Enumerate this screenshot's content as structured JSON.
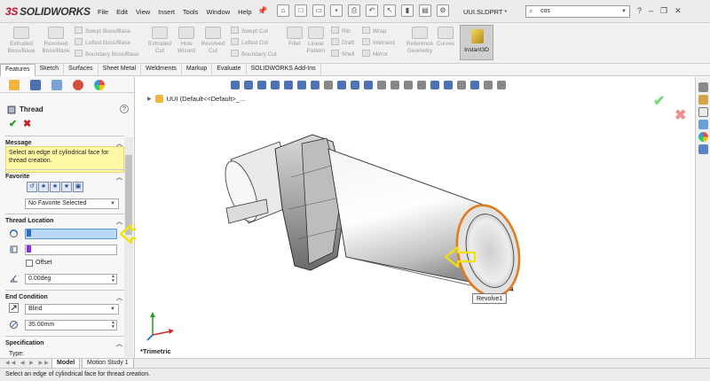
{
  "app": {
    "brand_ds": "3S",
    "brand_name": "SOLIDWORKS",
    "menu": [
      "File",
      "Edit",
      "View",
      "Insert",
      "Tools",
      "Window",
      "Help"
    ],
    "document": "UUI.SLDPRT *",
    "search_value": "cos"
  },
  "commands": {
    "extruded_boss": "Extruded Boss/Base",
    "revolved_boss": "Revolved Boss/Base",
    "swept_boss": "Swept Boss/Base",
    "lofted_boss": "Lofted Boss/Base",
    "boundary_boss": "Boundary Boss/Base",
    "extruded_cut": "Extruded Cut",
    "hole_wizard": "Hole Wizard",
    "revolved_cut": "Revolved Cut",
    "swept_cut": "Swept Cut",
    "lofted_cut": "Lofted Cut",
    "boundary_cut": "Boundary Cut",
    "fillet": "Fillet",
    "linear_pattern": "Linear Pattern",
    "rib": "Rib",
    "draft": "Draft",
    "shell": "Shell",
    "wrap": "Wrap",
    "intersect": "Intersect",
    "mirror": "Mirror",
    "reference_geometry": "Reference Geometry",
    "curves": "Curves",
    "instant3d": "Instant3D"
  },
  "tabs": [
    "Features",
    "Sketch",
    "Surfaces",
    "Sheet Metal",
    "Weldments",
    "Markup",
    "Evaluate",
    "SOLIDWORKS Add-Ins"
  ],
  "property_manager": {
    "title": "Thread",
    "help": "?",
    "ok_symbol": "✔",
    "cancel_symbol": "✖",
    "message_header": "Message",
    "message_text": "Select an edge of cylindrical face for thread creation.",
    "favorite_header": "Favorite",
    "favorite_selected": "No Favorite Selected",
    "thread_location_header": "Thread Location",
    "offset_label": "Offset",
    "angle_value": "0.00deg",
    "end_condition_header": "End Condition",
    "end_condition_value": "Blind",
    "depth_value": "35.00mm",
    "specification_header": "Specification",
    "type_label": "Type:"
  },
  "viewport": {
    "tree_label": "UUI  (Default<<Default>_...",
    "view_name": "*Trimetric",
    "tooltip": "Revolve1"
  },
  "bottom_tabs": [
    "Model",
    "Motion Study 1"
  ],
  "status_text": "Select an edge of cylindrical face for thread creation.",
  "colors": {
    "accent_orange": "#e07b1f",
    "arrow_yellow": "#f2e200",
    "message_bg": "#fff9a6",
    "selection_blue": "#bcd8f7"
  }
}
